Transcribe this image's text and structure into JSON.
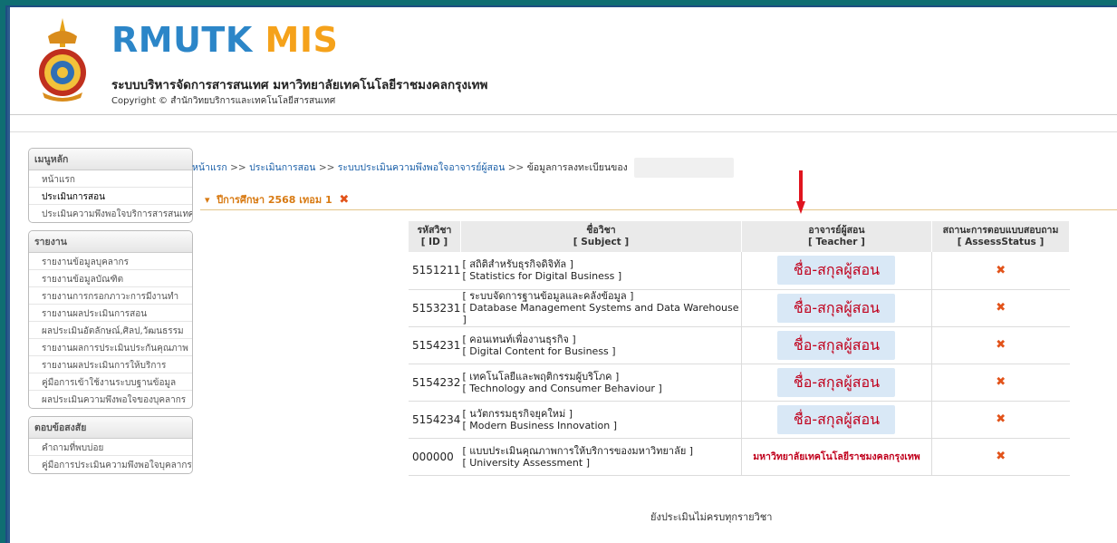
{
  "header": {
    "brand_part1": "RMUTK",
    "brand_part2": "MIS",
    "subtitle": "ระบบบริหารจัดการสารสนเทศ มหาวิทยาลัยเทคโนโลยีราชมงคลกรุงเทพ",
    "copyright": "Copyright © สำนักวิทยบริการและเทคโนโลยีสารสนเทศ"
  },
  "sidebar": {
    "menu_title": "เมนูหลัก",
    "menu_items": [
      {
        "label": "หน้าแรก"
      },
      {
        "label": "ประเมินการสอน"
      },
      {
        "label": "ประเมินความพึงพอใจบริการสารสนเทศ"
      }
    ],
    "report_title": "รายงาน",
    "report_items": [
      {
        "label": "รายงานข้อมูลบุคลากร"
      },
      {
        "label": "รายงานข้อมูลบัณฑิต"
      },
      {
        "label": "รายงานการกรอกภาวะการมีงานทำ"
      },
      {
        "label": "รายงานผลประเมินการสอน"
      },
      {
        "label": "ผลประเมินอัตลักษณ์,ศิลป,วัฒนธรรม"
      },
      {
        "label": "รายงานผลการประเมินประกันคุณภาพ"
      },
      {
        "label": "รายงานผลประเมินการให้บริการ"
      },
      {
        "label": "คู่มือการเข้าใช้งานระบบฐานข้อมูล"
      },
      {
        "label": "ผลประเมินความพึงพอใจของบุคลากร"
      }
    ],
    "faq_title": "ตอบข้อสงสัย",
    "faq_items": [
      {
        "label": "คำถามที่พบบ่อย"
      },
      {
        "label": "คู่มือการประเมินความพึงพอใจบุคลากร"
      }
    ]
  },
  "breadcrumb": {
    "home": "หน้าแรก",
    "teaching": "ประเมินการสอน",
    "satisfaction": "ระบบประเมินความพึงพอใจอาจารย์ผู้สอน",
    "current": "ข้อมูลการลงทะเบียนของ",
    "sep": ">>"
  },
  "year": {
    "label": "ปีการศึกษา 2568 เทอม 1"
  },
  "table": {
    "headers": {
      "id_th": "รหัสวิชา",
      "id_en": "[ ID ]",
      "subject_th": "ชื่อวิชา",
      "subject_en": "[ Subject ]",
      "teacher_th": "อาจารย์ผู้สอน",
      "teacher_en": "[ Teacher ]",
      "status_th": "สถานะการตอบแบบสอบถาม",
      "status_en": "[ AssessStatus ]"
    },
    "rows": [
      {
        "id": "5151211",
        "th": "[ สถิติสำหรับธุรกิจดิจิทัล ]",
        "en": "[ Statistics for Digital Business ]",
        "teacher": "ชื่อ-สกุลผู้สอน"
      },
      {
        "id": "5153231",
        "th": "[ ระบบจัดการฐานข้อมูลและคลังข้อมูล ]",
        "en": "[ Database Management Systems and Data Warehouse ]",
        "teacher": "ชื่อ-สกุลผู้สอน"
      },
      {
        "id": "5154231",
        "th": "[ คอนเทนท์เพื่องานธุรกิจ ]",
        "en": "[ Digital Content for Business ]",
        "teacher": "ชื่อ-สกุลผู้สอน"
      },
      {
        "id": "5154232",
        "th": "[ เทคโนโลยีและพฤติกรรมผู้บริโภค ]",
        "en": "[ Technology and Consumer Behaviour ]",
        "teacher": "ชื่อ-สกุลผู้สอน"
      },
      {
        "id": "5154234",
        "th": "[ นวัตกรรมธุรกิจยุคใหม่ ]",
        "en": "[ Modern Business Innovation ]",
        "teacher": "ชื่อ-สกุลผู้สอน"
      },
      {
        "id": "000000",
        "th": "[ แบบประเมินคุณภาพการให้บริการของมหาวิทยาลัย ]",
        "en": "[ University Assessment ]",
        "teacher": "มหาวิทยาลัยเทคโนโลยีราชมงคลกรุงเทพ"
      }
    ]
  },
  "footer_note": "ยังประเมินไม่ครบทุกรายวิชา",
  "colors": {
    "brand_blue": "#2c86c8",
    "brand_orange": "#f5a21b",
    "teacher_red": "#c0001c",
    "status_icon": "#e2531a",
    "arrow_red": "#e0141e"
  },
  "icons": {
    "status": "x-mark-icon",
    "year_toggle": "triangle-down-icon",
    "annotation": "red-down-arrow-icon"
  }
}
